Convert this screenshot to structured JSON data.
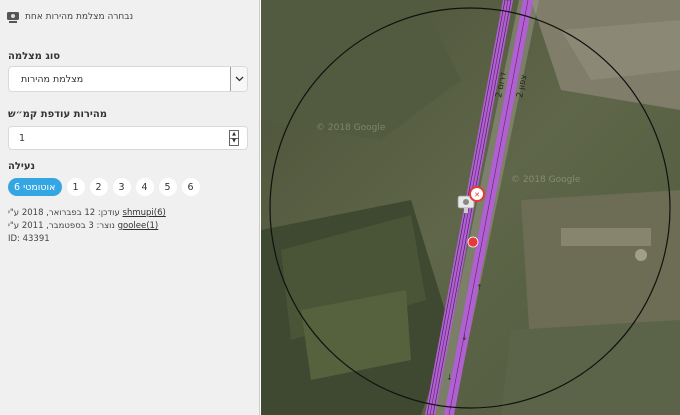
{
  "header": {
    "title": "נבחרה מצלמת מהירות אחת",
    "icon": "camera-icon"
  },
  "camera_type": {
    "label": "סוג מצלמה",
    "value": "מצלמת מהירות"
  },
  "speed": {
    "label": "מהירות עודפת קמ״ש",
    "value": "1"
  },
  "lock": {
    "label": "נעילה",
    "auto_label": "אוטומטי 6",
    "levels": [
      "1",
      "2",
      "3",
      "4",
      "5",
      "6"
    ]
  },
  "meta": {
    "updated_user": "shmupi(6)",
    "updated_text": "עודכן: 12 בפברואר, 2018 ע\"י",
    "created_user": "goolee(1)",
    "created_text": "נוצר: 3 בספטמבר, 2011 ע\"י",
    "id_text": "ID: 43391"
  },
  "map": {
    "road_label_1": "2 דרום",
    "road_label_2": "2 צפון",
    "watermark_1": "© 2018 Google",
    "watermark_2": "© 2018 Google",
    "road_color": "#b060d0",
    "camera_marker_color": "#e53935",
    "node_color": "#e53935"
  }
}
